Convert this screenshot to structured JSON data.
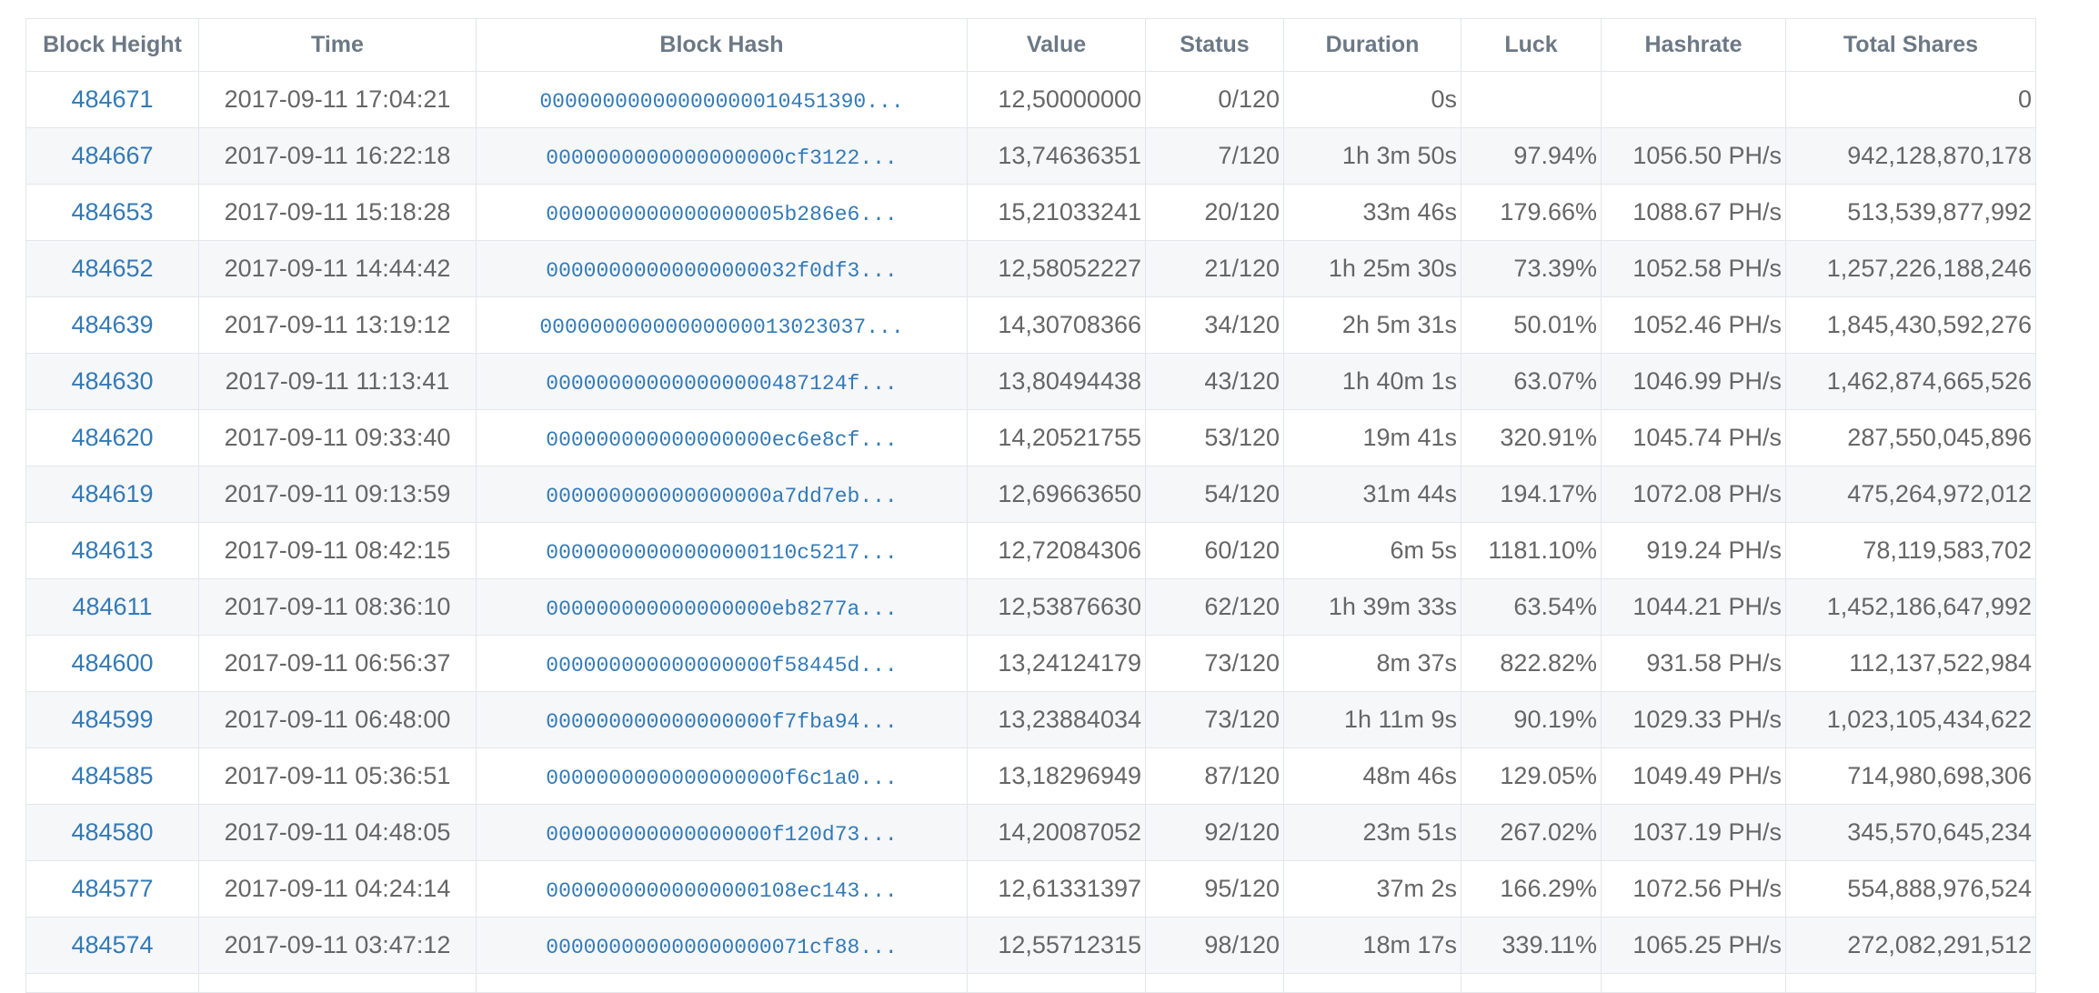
{
  "columns": {
    "block_height": "Block Height",
    "time": "Time",
    "block_hash": "Block Hash",
    "value": "Value",
    "status": "Status",
    "duration": "Duration",
    "luck": "Luck",
    "hashrate": "Hashrate",
    "total_shares": "Total Shares"
  },
  "colors": {
    "link": "#337ab7",
    "luck_good": "#008000",
    "luck_bad": "#e5000f",
    "header_text": "#6c7885",
    "cell_text": "#666666"
  },
  "rows": [
    {
      "height": "484671",
      "time": "2017-09-11 17:04:21",
      "hash": "00000000000000000010451390...",
      "value": "12,50000000",
      "status": "0/120",
      "duration": "0s",
      "luck": "",
      "luck_state": "none",
      "hashrate": "",
      "shares": "0"
    },
    {
      "height": "484667",
      "time": "2017-09-11 16:22:18",
      "hash": "0000000000000000000cf3122...",
      "value": "13,74636351",
      "status": "7/120",
      "duration": "1h 3m 50s",
      "luck": "97.94%",
      "luck_state": "bad",
      "hashrate": "1056.50 PH/s",
      "shares": "942,128,870,178"
    },
    {
      "height": "484653",
      "time": "2017-09-11 15:18:28",
      "hash": "0000000000000000005b286e6...",
      "value": "15,21033241",
      "status": "20/120",
      "duration": "33m 46s",
      "luck": "179.66%",
      "luck_state": "good",
      "hashrate": "1088.67 PH/s",
      "shares": "513,539,877,992"
    },
    {
      "height": "484652",
      "time": "2017-09-11 14:44:42",
      "hash": "00000000000000000032f0df3...",
      "value": "12,58052227",
      "status": "21/120",
      "duration": "1h 25m 30s",
      "luck": "73.39%",
      "luck_state": "bad",
      "hashrate": "1052.58 PH/s",
      "shares": "1,257,226,188,246"
    },
    {
      "height": "484639",
      "time": "2017-09-11 13:19:12",
      "hash": "00000000000000000013023037...",
      "value": "14,30708366",
      "status": "34/120",
      "duration": "2h 5m 31s",
      "luck": "50.01%",
      "luck_state": "bad",
      "hashrate": "1052.46 PH/s",
      "shares": "1,845,430,592,276"
    },
    {
      "height": "484630",
      "time": "2017-09-11 11:13:41",
      "hash": "000000000000000000487124f...",
      "value": "13,80494438",
      "status": "43/120",
      "duration": "1h 40m 1s",
      "luck": "63.07%",
      "luck_state": "bad",
      "hashrate": "1046.99 PH/s",
      "shares": "1,462,874,665,526"
    },
    {
      "height": "484620",
      "time": "2017-09-11 09:33:40",
      "hash": "000000000000000000ec6e8cf...",
      "value": "14,20521755",
      "status": "53/120",
      "duration": "19m 41s",
      "luck": "320.91%",
      "luck_state": "good",
      "hashrate": "1045.74 PH/s",
      "shares": "287,550,045,896"
    },
    {
      "height": "484619",
      "time": "2017-09-11 09:13:59",
      "hash": "000000000000000000a7dd7eb...",
      "value": "12,69663650",
      "status": "54/120",
      "duration": "31m 44s",
      "luck": "194.17%",
      "luck_state": "good",
      "hashrate": "1072.08 PH/s",
      "shares": "475,264,972,012"
    },
    {
      "height": "484613",
      "time": "2017-09-11 08:42:15",
      "hash": "00000000000000000110c5217...",
      "value": "12,72084306",
      "status": "60/120",
      "duration": "6m 5s",
      "luck": "1181.10%",
      "luck_state": "good",
      "hashrate": "919.24 PH/s",
      "shares": "78,119,583,702"
    },
    {
      "height": "484611",
      "time": "2017-09-11 08:36:10",
      "hash": "000000000000000000eb8277a...",
      "value": "12,53876630",
      "status": "62/120",
      "duration": "1h 39m 33s",
      "luck": "63.54%",
      "luck_state": "bad",
      "hashrate": "1044.21 PH/s",
      "shares": "1,452,186,647,992"
    },
    {
      "height": "484600",
      "time": "2017-09-11 06:56:37",
      "hash": "000000000000000000f58445d...",
      "value": "13,24124179",
      "status": "73/120",
      "duration": "8m 37s",
      "luck": "822.82%",
      "luck_state": "good",
      "hashrate": "931.58 PH/s",
      "shares": "112,137,522,984"
    },
    {
      "height": "484599",
      "time": "2017-09-11 06:48:00",
      "hash": "000000000000000000f7fba94...",
      "value": "13,23884034",
      "status": "73/120",
      "duration": "1h 11m 9s",
      "luck": "90.19%",
      "luck_state": "bad",
      "hashrate": "1029.33 PH/s",
      "shares": "1,023,105,434,622"
    },
    {
      "height": "484585",
      "time": "2017-09-11 05:36:51",
      "hash": "0000000000000000000f6c1a0...",
      "value": "13,18296949",
      "status": "87/120",
      "duration": "48m 46s",
      "luck": "129.05%",
      "luck_state": "good",
      "hashrate": "1049.49 PH/s",
      "shares": "714,980,698,306"
    },
    {
      "height": "484580",
      "time": "2017-09-11 04:48:05",
      "hash": "000000000000000000f120d73...",
      "value": "14,20087052",
      "status": "92/120",
      "duration": "23m 51s",
      "luck": "267.02%",
      "luck_state": "good",
      "hashrate": "1037.19 PH/s",
      "shares": "345,570,645,234"
    },
    {
      "height": "484577",
      "time": "2017-09-11 04:24:14",
      "hash": "00000000000000000108ec143...",
      "value": "12,61331397",
      "status": "95/120",
      "duration": "37m 2s",
      "luck": "166.29%",
      "luck_state": "good",
      "hashrate": "1072.56 PH/s",
      "shares": "554,888,976,524"
    },
    {
      "height": "484574",
      "time": "2017-09-11 03:47:12",
      "hash": "000000000000000000071cf88...",
      "value": "12,55712315",
      "status": "98/120",
      "duration": "18m 17s",
      "luck": "339.11%",
      "luck_state": "good",
      "hashrate": "1065.25 PH/s",
      "shares": "272,082,291,512"
    }
  ]
}
